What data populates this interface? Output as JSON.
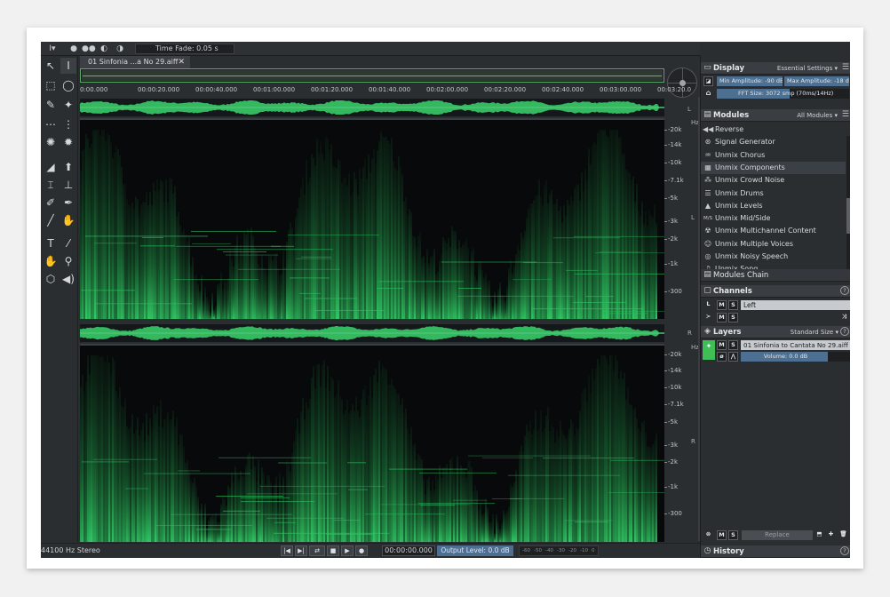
{
  "topbar": {
    "time_fade": "Time Fade: 0.05 s"
  },
  "file_tab": {
    "label": "01 Sinfonia ...a No 29.aiff",
    "close": "✕"
  },
  "ruler": {
    "ticks": [
      "0:00.000",
      "00:00:20.000",
      "00:00:40.000",
      "00:01:00.000",
      "00:01:20.000",
      "00:01:40.000",
      "00:02:00.000",
      "00:02:20.000",
      "00:02:40.000",
      "00:03:00.000",
      "00:03:20.0"
    ]
  },
  "freq_scale": {
    "labels": [
      "20k",
      "14k",
      "10k",
      "7.1k",
      "5k",
      "3k",
      "2k",
      "1k",
      "300"
    ],
    "unit": "Hz"
  },
  "channels_letters": {
    "left": "L",
    "right": "R"
  },
  "status": {
    "sample_rate": "44100 Hz Stereo",
    "timecode": "00:00:00.000",
    "output_level": "Output Level: 0.0 dB",
    "meter_ticks": [
      "-60",
      "-50",
      "-40",
      "-30",
      "-20",
      "-10",
      "0"
    ]
  },
  "display_panel": {
    "title": "Display",
    "preset": "Essential Settings",
    "min_amplitude": "Min Amplitude: -90 dB",
    "max_amplitude": "Max Amplitude: -18 dB",
    "fft_size": "FFT Size: 3072 smp (70ms/14Hz)"
  },
  "modules_panel": {
    "title": "Modules",
    "filter": "All Modules",
    "items": [
      {
        "icon": "reverse-icon",
        "glyph": "◀◀",
        "label": "Reverse"
      },
      {
        "icon": "signal-generator-icon",
        "glyph": "⊛",
        "label": "Signal Generator"
      },
      {
        "icon": "unmix-chorus-icon",
        "glyph": "♒",
        "label": "Unmix Chorus"
      },
      {
        "icon": "unmix-components-icon",
        "glyph": "▦",
        "label": "Unmix Components"
      },
      {
        "icon": "unmix-crowd-noise-icon",
        "glyph": "⁂",
        "label": "Unmix Crowd Noise"
      },
      {
        "icon": "unmix-drums-icon",
        "glyph": "☰",
        "label": "Unmix Drums"
      },
      {
        "icon": "unmix-levels-icon",
        "glyph": "▲",
        "label": "Unmix Levels"
      },
      {
        "icon": "unmix-mid-side-icon",
        "glyph": "M/S",
        "label": "Unmix Mid/Side"
      },
      {
        "icon": "unmix-multichannel-icon",
        "glyph": "☢",
        "label": "Unmix Multichannel Content"
      },
      {
        "icon": "unmix-multiple-voices-icon",
        "glyph": "☺",
        "label": "Unmix Multiple Voices"
      },
      {
        "icon": "unmix-noisy-speech-icon",
        "glyph": "◎",
        "label": "Unmix Noisy Speech"
      },
      {
        "icon": "unmix-song-icon",
        "glyph": "♫",
        "label": "Unmix Song"
      }
    ],
    "chain_label": "Modules Chain"
  },
  "channels_panel": {
    "title": "Channels",
    "channel_name": "Left",
    "btn_l": "L",
    "btn_m": "M",
    "btn_s": "S"
  },
  "layers_panel": {
    "title": "Layers",
    "size": "Standard Size",
    "layer_name": "01 Sinfonia to Cantata No 29.aiff",
    "volume": "Volume: 0.0 dB",
    "btn_m": "M",
    "btn_s": "S",
    "blend_mode": "Replace"
  },
  "history_panel": {
    "title": "History"
  },
  "colors": {
    "spectrogram": "#2ec463",
    "waveform": "#34b860",
    "accent_blue": "#4d6f92",
    "panel_bg": "#2b2e31"
  }
}
